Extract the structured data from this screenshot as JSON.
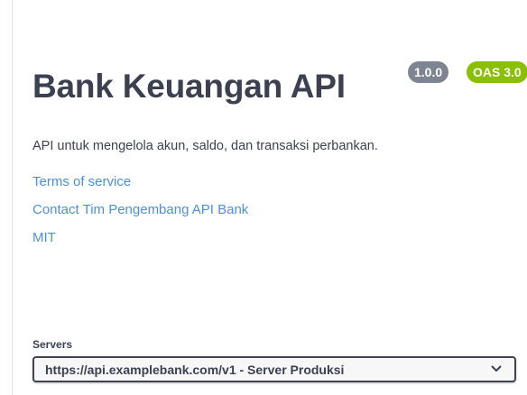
{
  "info": {
    "title": "Bank Keuangan API",
    "version_badge": "1.0.0",
    "oas_badge": "OAS 3.0",
    "description": "API untuk mengelola akun, saldo, dan transaksi perbankan.",
    "links": {
      "terms": "Terms of service",
      "contact": "Contact Tim Pengembang API Bank",
      "license": "MIT"
    }
  },
  "servers": {
    "label": "Servers",
    "selected": "https://api.examplebank.com/v1 - Server Produksi",
    "dropdown_icon": "chevron-down-icon"
  },
  "colors": {
    "text": "#3b4151",
    "link": "#4990e2",
    "version_badge": "#7d8492",
    "oas_badge": "#89bf04"
  }
}
